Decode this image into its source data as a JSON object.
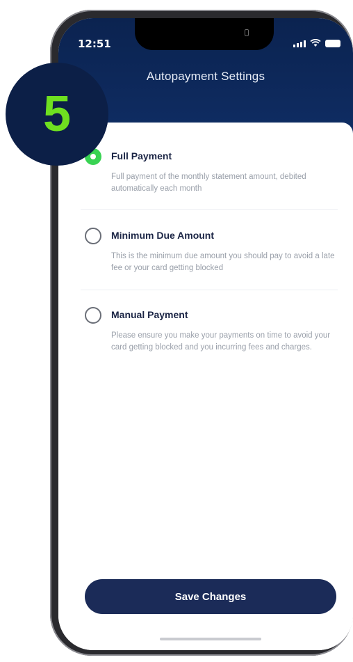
{
  "status_bar": {
    "time": "12:51"
  },
  "header": {
    "title": "Autopayment Settings"
  },
  "options": [
    {
      "title": "Full Payment",
      "description": "Full payment of the monthly statement amount, debited automatically each month",
      "selected": true
    },
    {
      "title": "Minimum Due Amount",
      "description": "This is the minimum due amount you should pay to avoid a late fee or your card getting blocked",
      "selected": false
    },
    {
      "title": "Manual Payment",
      "description": "Please ensure you make your payments on time to avoid your card getting blocked and you incurring fees and charges.",
      "selected": false
    }
  ],
  "footer": {
    "save_label": "Save Changes"
  },
  "step_badge": {
    "number": "5"
  },
  "colors": {
    "header": "#0e2a5e",
    "selected_radio": "#39d353",
    "button": "#1b2b58",
    "badge": "#0c1f47",
    "badge_number": "#6fe020"
  },
  "icons": [
    "back-arrow-icon",
    "signal-icon",
    "wifi-icon",
    "battery-icon"
  ]
}
